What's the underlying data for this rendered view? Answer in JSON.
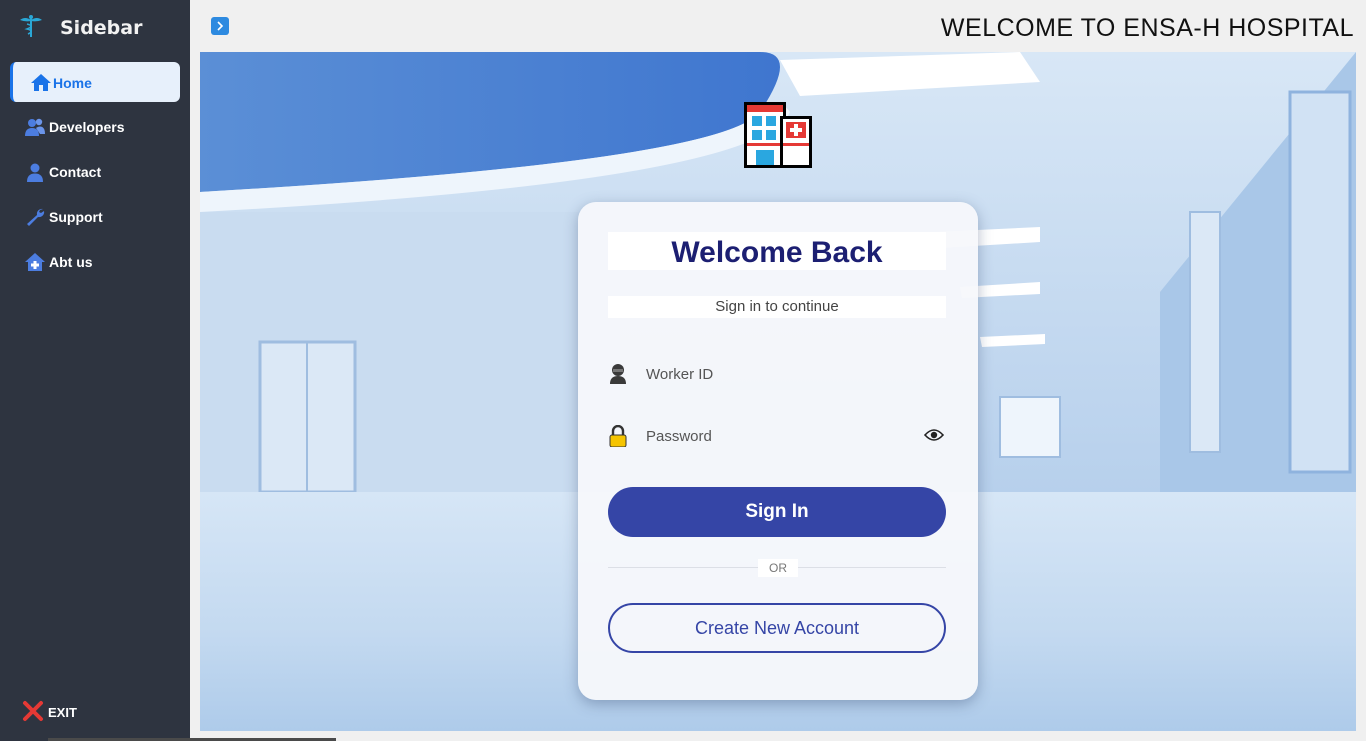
{
  "sidebar": {
    "title": "Sidebar",
    "items": [
      {
        "label": "Home",
        "icon": "home-icon"
      },
      {
        "label": "Developers",
        "icon": "users-icon"
      },
      {
        "label": "Contact",
        "icon": "user-icon"
      },
      {
        "label": "Support",
        "icon": "wrench-icon"
      },
      {
        "label": "Abt us",
        "icon": "house-plus-icon"
      }
    ],
    "exit_label": "EXIT"
  },
  "header": {
    "title": "WELCOME TO ENSA-H HOSPITAL"
  },
  "login": {
    "title": "Welcome Back",
    "subtitle": "Sign in to continue",
    "worker_id_placeholder": "Worker ID",
    "password_placeholder": "Password",
    "sign_in_label": "Sign In",
    "or_label": "OR",
    "create_account_label": "Create New Account"
  },
  "colors": {
    "sidebar_bg": "#2e3440",
    "accent": "#1a73e8",
    "primary_button": "#3545a6",
    "title_text": "#1c1f72"
  }
}
